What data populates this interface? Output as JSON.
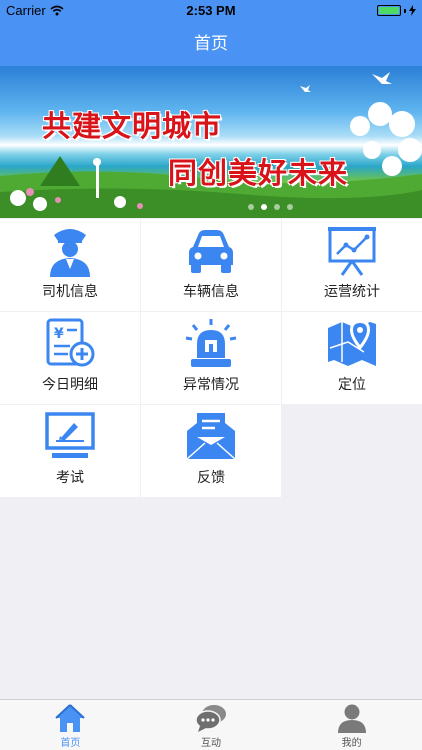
{
  "status_bar": {
    "carrier": "Carrier",
    "time": "2:53 PM"
  },
  "nav": {
    "title": "首页"
  },
  "banner": {
    "line1": "共建文明城市",
    "line2": "同创美好未来",
    "page_count": 4,
    "active_page": 2
  },
  "grid": [
    {
      "label": "司机信息",
      "icon": "driver-icon"
    },
    {
      "label": "车辆信息",
      "icon": "car-icon"
    },
    {
      "label": "运营统计",
      "icon": "chart-board-icon"
    },
    {
      "label": "今日明细",
      "icon": "daily-detail-icon"
    },
    {
      "label": "异常情况",
      "icon": "alarm-light-icon"
    },
    {
      "label": "定位",
      "icon": "map-pin-icon"
    },
    {
      "label": "考试",
      "icon": "exam-screen-icon"
    },
    {
      "label": "反馈",
      "icon": "feedback-envelope-icon"
    }
  ],
  "tabs": [
    {
      "label": "首页",
      "icon": "home-icon",
      "active": true
    },
    {
      "label": "互动",
      "icon": "chat-bubbles-icon",
      "active": false
    },
    {
      "label": "我的",
      "icon": "person-icon",
      "active": false
    }
  ],
  "colors": {
    "primary": "#4a93f5",
    "icon_blue": "#3b86f0",
    "slogan_red": "#d8141a",
    "background": "#efeff4"
  }
}
